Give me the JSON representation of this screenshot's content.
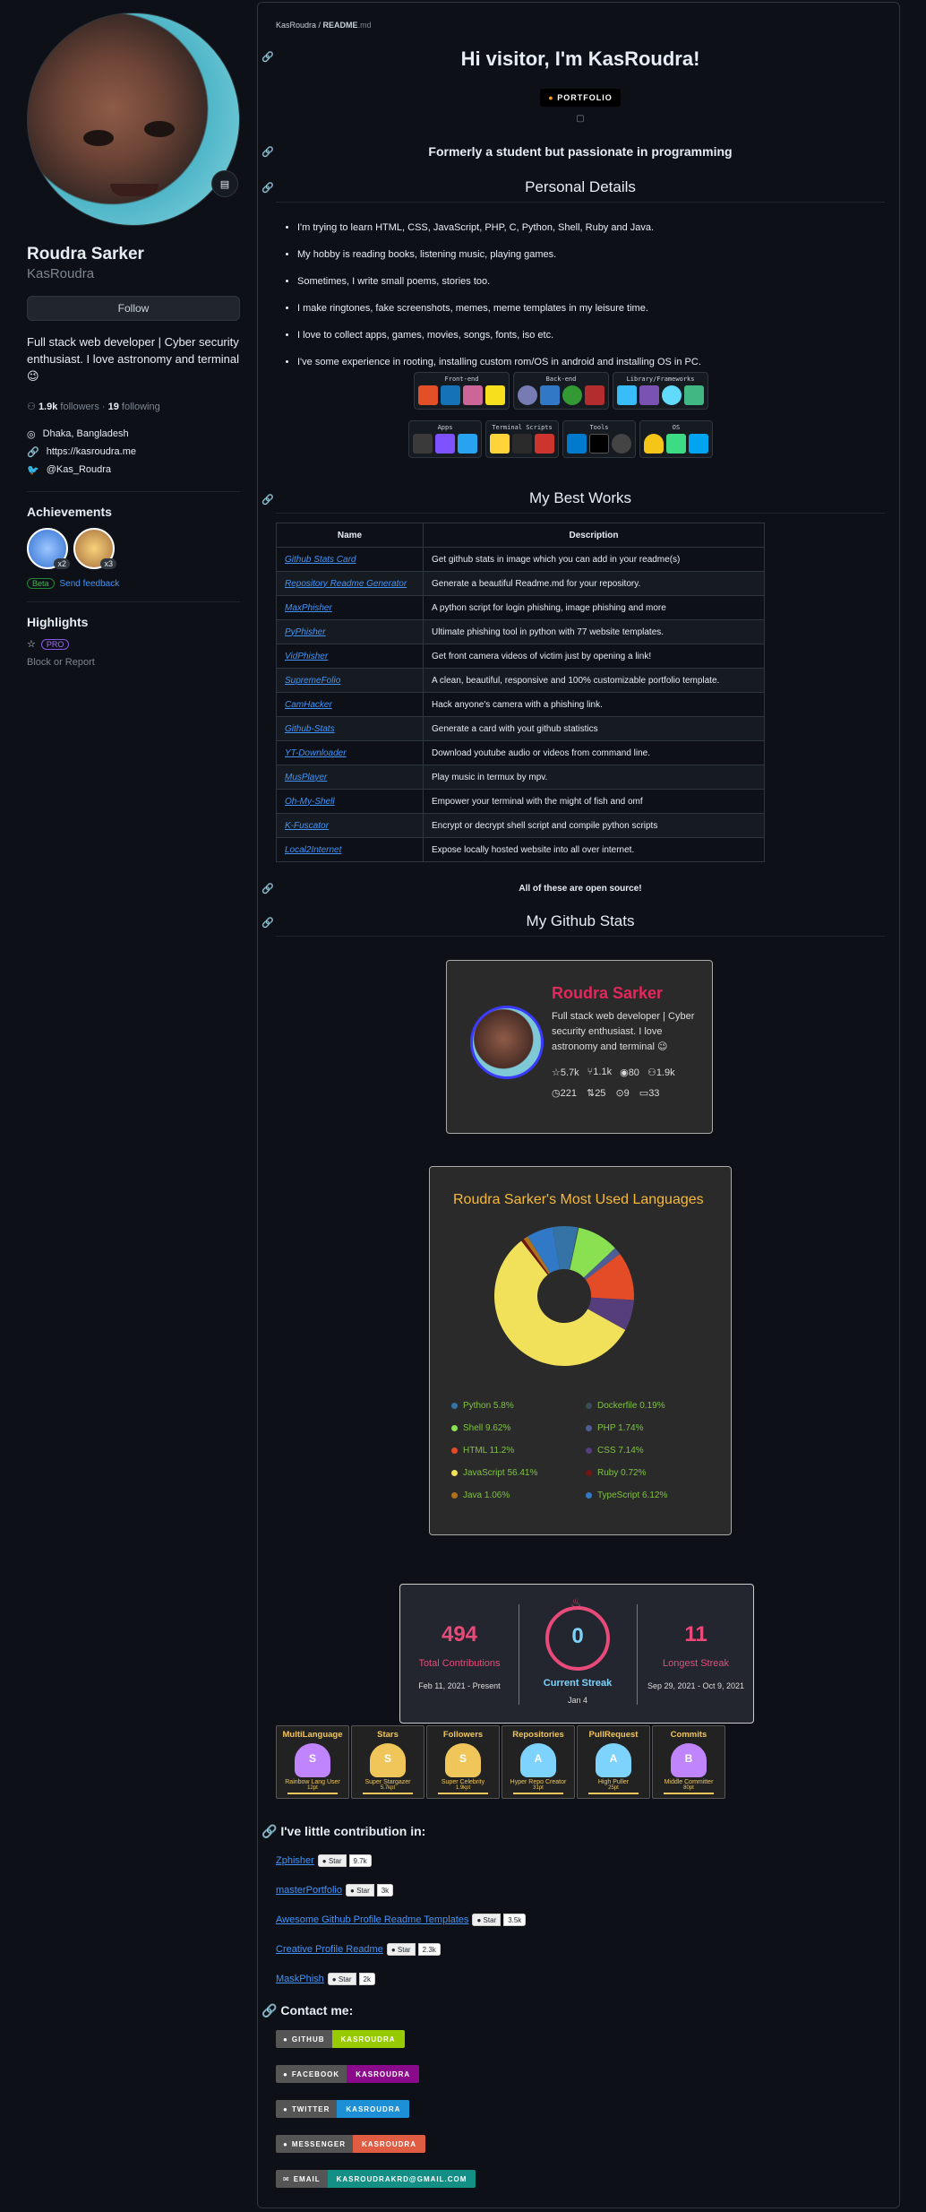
{
  "profile": {
    "name": "Roudra Sarker",
    "login": "KasRoudra",
    "follow_label": "Follow",
    "bio": "Full stack web developer | Cyber security enthusiast. I love astronomy and terminal 😉",
    "followers": "1.9k",
    "followers_label": "followers",
    "following": "19",
    "following_label": "following",
    "location": "Dhaka, Bangladesh",
    "website": "https://kasroudra.me",
    "twitter": "@Kas_Roudra",
    "achievements_title": "Achievements",
    "achievement_counts": [
      "x2",
      "x3"
    ],
    "beta": "Beta",
    "send_feedback": "Send feedback",
    "highlights_title": "Highlights",
    "pro": "PRO",
    "block_report": "Block or Report"
  },
  "readme": {
    "breadcrumb_user": "KasRoudra",
    "breadcrumb_sep": " / ",
    "breadcrumb_file": "README",
    "breadcrumb_ext": ".md",
    "heading": "Hi visitor, I'm KasRoudra!",
    "portfolio_badge": "PORTFOLIO",
    "tagline": "Formerly a student but passionate in programming",
    "personal_title": "Personal Details",
    "details": [
      "I'm trying to learn HTML, CSS, JavaScript, PHP, C, Python, Shell, Ruby and Java.",
      "My hobby is reading books, listening music, playing games.",
      "Sometimes, I write small poems, stories too.",
      "I make ringtones, fake screenshots, memes, meme templates in my leisure time.",
      "I love to collect apps, games, movies, songs, fonts, iso etc.",
      "I've some experience in rooting, installing custom rom/OS in android and installing OS in PC."
    ],
    "tech_groups": [
      "Front-end",
      "Back-end",
      "Library/Frameworks",
      "Apps",
      "Terminal Scripts",
      "Tools",
      "OS"
    ],
    "works_title": "My Best Works",
    "works_headers": [
      "Name",
      "Description"
    ],
    "works": [
      {
        "name": "Github Stats Card",
        "desc": "Get github stats in image which you can add in your readme(s)"
      },
      {
        "name": "Repository Readme Generator",
        "desc": "Generate a beautiful Readme.md for your repository."
      },
      {
        "name": "MaxPhisher",
        "desc": "A python script for login phishing, image phishing and more"
      },
      {
        "name": "PyPhisher",
        "desc": "Ultimate phishing tool in python with 77 website templates."
      },
      {
        "name": "VidPhisher",
        "desc": "Get front camera videos of victim just by opening a link!"
      },
      {
        "name": "SupremeFolio",
        "desc": "A clean, beautiful, responsive and 100% customizable portfolio template."
      },
      {
        "name": "CamHacker",
        "desc": "Hack anyone's camera with a phishing link."
      },
      {
        "name": "Github-Stats",
        "desc": "Generate a card with yout github statistics"
      },
      {
        "name": "YT-Downloader",
        "desc": "Download youtube audio or videos from command line."
      },
      {
        "name": "MusPlayer",
        "desc": "Play music in termux by mpv."
      },
      {
        "name": "Oh-My-Shell",
        "desc": "Empower your terminal with the might of fish and omf"
      },
      {
        "name": "K-Fuscator",
        "desc": "Encrypt or decrypt shell script and compile python scripts"
      },
      {
        "name": "Local2Internet",
        "desc": "Expose locally hosted website into all over internet."
      }
    ],
    "open_source_note": "All of these are open source!",
    "stats_title": "My Github Stats",
    "stats_card": {
      "name": "Roudra Sarker",
      "bio": "Full stack web developer | Cyber security enthusiast. I love astronomy and terminal 😉",
      "stars": "5.7k",
      "forks": "1.1k",
      "watchers": "80",
      "followers": "1.9k",
      "commits": "221",
      "prs": "25",
      "issues": "9",
      "discussions": "33"
    },
    "lang_card_title": "Roudra Sarker's Most Used Languages",
    "streak": {
      "total": "494",
      "total_label": "Total Contributions",
      "total_range": "Feb 11, 2021 - Present",
      "current": "0",
      "current_label": "Current Streak",
      "current_date": "Jan 4",
      "longest": "11",
      "longest_label": "Longest Streak",
      "longest_range": "Sep 29, 2021 - Oct 9, 2021"
    },
    "trophies": [
      {
        "title": "MultiLanguage",
        "rank": "S",
        "sub": "Rainbow Lang User",
        "pts": "12pt",
        "color": "#c084fc"
      },
      {
        "title": "Stars",
        "rank": "S",
        "sub": "Super Stargazer",
        "pts": "5.7kpt",
        "color": "#f0c65b"
      },
      {
        "title": "Followers",
        "rank": "S",
        "sub": "Super Celebrity",
        "pts": "1.9kpt",
        "color": "#f0c65b"
      },
      {
        "title": "Repositories",
        "rank": "A",
        "sub": "Hyper Repo Creator",
        "pts": "31pt",
        "color": "#7dd3fc"
      },
      {
        "title": "PullRequest",
        "rank": "A",
        "sub": "High Puller",
        "pts": "25pt",
        "color": "#7dd3fc"
      },
      {
        "title": "Commits",
        "rank": "B",
        "sub": "Middle Committer",
        "pts": "80pt",
        "color": "#c084fc"
      }
    ],
    "contrib_title": "I've little contribution in:",
    "contribs": [
      {
        "name": "Zphisher",
        "star": "Star",
        "count": "9.7k"
      },
      {
        "name": "masterPortfolio",
        "star": "Star",
        "count": "3k"
      },
      {
        "name": "Awesome Github Profile Readme Templates",
        "star": "Star",
        "count": "3.5k"
      },
      {
        "name": "Creative Profile Readme",
        "star": "Star",
        "count": "2.3k"
      },
      {
        "name": "MaskPhish",
        "star": "Star",
        "count": "2k"
      }
    ],
    "contact_title": "Contact me:",
    "contacts": [
      {
        "label": "GITHUB",
        "value": "KASROUDRA",
        "color": "#97ca00"
      },
      {
        "label": "FACEBOOK",
        "value": "KASROUDRA",
        "color": "#8b0a8b"
      },
      {
        "label": "TWITTER",
        "value": "KASROUDRA",
        "color": "#1d8fd6"
      },
      {
        "label": "MESSENGER",
        "value": "KASROUDRA",
        "color": "#e05d44"
      },
      {
        "label": "EMAIL",
        "value": "KASROUDRAKRD@GMAIL.COM",
        "color": "#138f86"
      }
    ]
  },
  "chart_data": {
    "type": "pie",
    "title": "Roudra Sarker's Most Used Languages",
    "categories": [
      "Python",
      "Dockerfile",
      "Shell",
      "PHP",
      "HTML",
      "CSS",
      "JavaScript",
      "Ruby",
      "Java",
      "TypeScript"
    ],
    "values": [
      5.8,
      0.19,
      9.62,
      1.74,
      11.2,
      7.14,
      56.41,
      0.72,
      1.06,
      6.12
    ],
    "labels": [
      "Python 5.8%",
      "Dockerfile 0.19%",
      "Shell 9.62%",
      "PHP 1.74%",
      "HTML 11.2%",
      "CSS 7.14%",
      "JavaScript 56.41%",
      "Ruby 0.72%",
      "Java 1.06%",
      "TypeScript 6.12%"
    ],
    "colors": [
      "#3572A5",
      "#384d54",
      "#89e051",
      "#4F5D95",
      "#e34c26",
      "#563d7c",
      "#f1e05a",
      "#701516",
      "#b07219",
      "#3178c6"
    ],
    "legend_placement": "bottom"
  }
}
